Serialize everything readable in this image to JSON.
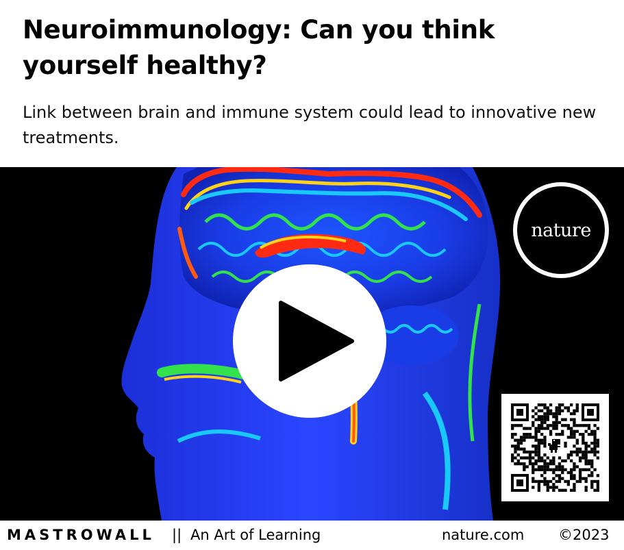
{
  "article": {
    "title": "Neuroimmunology: Can you think yourself healthy?",
    "subtitle": "Link between brain and immune system could lead to innovative new treatments."
  },
  "video": {
    "play_icon": "play-icon",
    "badge_text": "nature",
    "qr_icon": "qr-code-icon"
  },
  "footer": {
    "brand": "MASTROWALL",
    "separator": "||",
    "tagline": "An Art of Learning",
    "site": "nature.com",
    "copyright": "©2023"
  },
  "colors": {
    "background": "#000000",
    "scan_blue": "#1f3cff",
    "scan_cyan": "#19c8ff",
    "scan_green": "#33e24a",
    "scan_red": "#ff2a12",
    "scan_yellow": "#ffd21a",
    "badge": "#ffffff"
  }
}
